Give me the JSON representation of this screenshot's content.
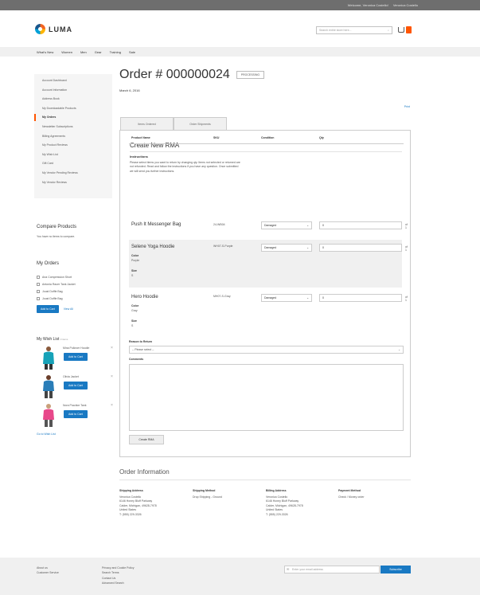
{
  "topbar": {
    "links": [
      "Welcome, Veronica Costello!",
      "Veronica Costello"
    ]
  },
  "header": {
    "logo_text": "LUMA",
    "search_placeholder": "Search entire store here...",
    "colors": {
      "accent": "#ff5501",
      "primary": "#1979c3"
    }
  },
  "nav": {
    "items": [
      "What's New",
      "Women",
      "Men",
      "Gear",
      "Training",
      "Sale"
    ]
  },
  "sidebar": {
    "items": [
      {
        "label": "Account Dashboard",
        "active": false
      },
      {
        "label": "Account Information",
        "active": false
      },
      {
        "label": "Address Book",
        "active": false
      },
      {
        "label": "My Downloadable Products",
        "active": false
      },
      {
        "label": "My Orders",
        "active": true
      },
      {
        "label": "Newsletter Subscriptions",
        "active": false
      },
      {
        "label": "Billing Agreements",
        "active": false
      },
      {
        "label": "My Product Reviews",
        "active": false
      },
      {
        "label": "My Wish List",
        "active": false
      },
      {
        "label": "Gift Card",
        "active": false
      },
      {
        "label": "My Vendor Pending Reviews",
        "active": false
      },
      {
        "label": "My Vendor Reviews",
        "active": false
      }
    ]
  },
  "compare": {
    "title": "Compare Products",
    "empty": "You have no items to compare."
  },
  "my_orders": {
    "title": "My Orders",
    "items": [
      "Ana Compression Short",
      "Antonia Racer Tank Jacket",
      "Joust Duffle Bag",
      "Joust Duffle Bag"
    ],
    "add_to_cart": "Add to Cart",
    "view_all": "View All"
  },
  "wishlist": {
    "title": "My Wish List",
    "count": "3 items",
    "items": [
      {
        "name": "Mina Pullover Hoodie",
        "button": "Add to Cart"
      },
      {
        "name": "Olivia Jacket",
        "button": "Add to Cart"
      },
      {
        "name": "Nora Practice Tank",
        "button": "Add to Cart"
      }
    ],
    "go_to_wishlist": "Go to Wish List"
  },
  "order": {
    "title": "Order # 000000024",
    "status": "Processing",
    "date": "March 6, 2016",
    "print": "Print"
  },
  "tabs": [
    "Items Ordered",
    "Order Shipments"
  ],
  "rma": {
    "title": "Create New RMA",
    "instructions_title": "Instructions",
    "instructions": "Please select items you want to return by changing qty. Items not selected or returned are not refunded. Read and follow the instructions if you have any question. Once submitted we will send you further instructions.",
    "columns": [
      "Product Name",
      "SKU",
      "Condition",
      "Qty"
    ],
    "rows": [
      {
        "name": "Push It Messenger Bag",
        "sku": "24-WB04",
        "condition": "Damaged",
        "qty": "0",
        "of": "of 1",
        "options": []
      },
      {
        "name": "Selene Yoga Hoodie",
        "sku": "WH07-S-Purple",
        "condition": "Damaged",
        "qty": "0",
        "of": "of 1",
        "options": [
          {
            "label": "Color",
            "value": "Purple"
          },
          {
            "label": "Size",
            "value": "S"
          }
        ]
      },
      {
        "name": "Hero Hoodie",
        "sku": "MH07-S-Gray",
        "condition": "Damaged",
        "qty": "0",
        "of": "of 1",
        "options": [
          {
            "label": "Color",
            "value": "Gray"
          },
          {
            "label": "Size",
            "value": "S"
          }
        ]
      }
    ],
    "reason_label": "Reason to Return",
    "reason_placeholder": "-- Please select --",
    "comments_label": "Comments",
    "create_button": "Create RMA"
  },
  "order_info": {
    "title": "Order Information",
    "columns": [
      {
        "title": "Shipping Address",
        "lines": [
          "Veronica Costello",
          "6146 Honey Bluff Parkway",
          "Calder, Michigan, 49628-7978",
          "United States",
          "T: (555) 229-3326"
        ]
      },
      {
        "title": "Shipping Method",
        "lines": [
          "Drop Shipping - Ground"
        ]
      },
      {
        "title": "Billing Address",
        "lines": [
          "Veronica Costello",
          "6146 Honey Bluff Parkway",
          "Calder, Michigan, 49628-7978",
          "United States",
          "T: (555) 229-3326"
        ]
      },
      {
        "title": "Payment Method",
        "lines": [
          "Check / Money order"
        ]
      }
    ]
  },
  "footer": {
    "col1": [
      "About us",
      "Customer Service"
    ],
    "col2": [
      "Privacy and Cookie Policy",
      "Search Terms",
      "Contact Us",
      "Advanced Search"
    ],
    "newsletter_placeholder": "Enter your email address",
    "subscribe": "Subscribe"
  }
}
